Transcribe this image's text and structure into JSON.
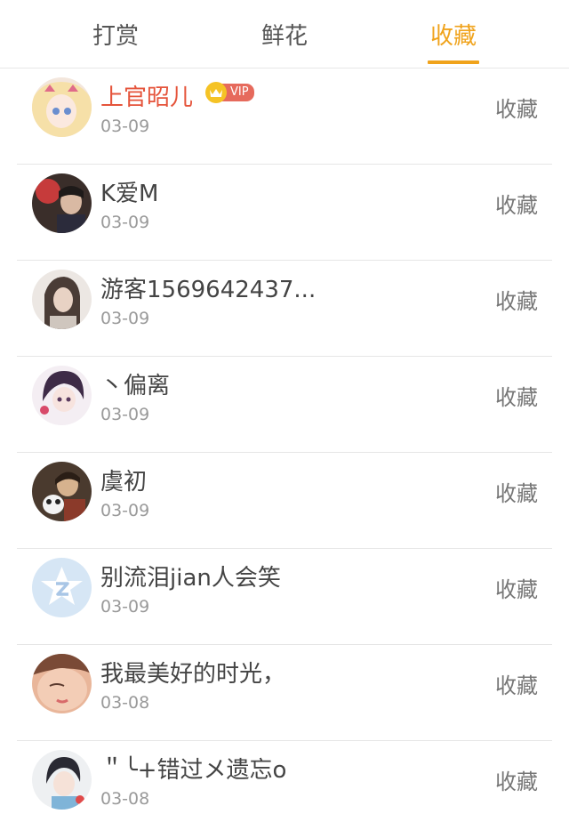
{
  "tabs": [
    {
      "label": "打赏"
    },
    {
      "label": "鲜花"
    },
    {
      "label": "收藏"
    }
  ],
  "active_tab": "收藏",
  "accent_color": "#f0a31c",
  "rows": [
    {
      "name": "上官昭儿",
      "date": "03-09",
      "action": "收藏",
      "vip": true,
      "vip_label": "VIP"
    },
    {
      "name": "K爱M",
      "date": "03-09",
      "action": "收藏"
    },
    {
      "name": "游客1569642437...",
      "date": "03-09",
      "action": "收藏"
    },
    {
      "name": "丶偏离",
      "date": "03-09",
      "action": "收藏"
    },
    {
      "name": "虞初",
      "date": "03-09",
      "action": "收藏"
    },
    {
      "name": "别流泪jian人会笑",
      "date": "03-09",
      "action": "收藏"
    },
    {
      "name": "我最美好的时光，",
      "date": "03-08",
      "action": "收藏"
    },
    {
      "name": "＂╰+错过メ遗忘o",
      "date": "03-08",
      "action": "收藏"
    }
  ]
}
